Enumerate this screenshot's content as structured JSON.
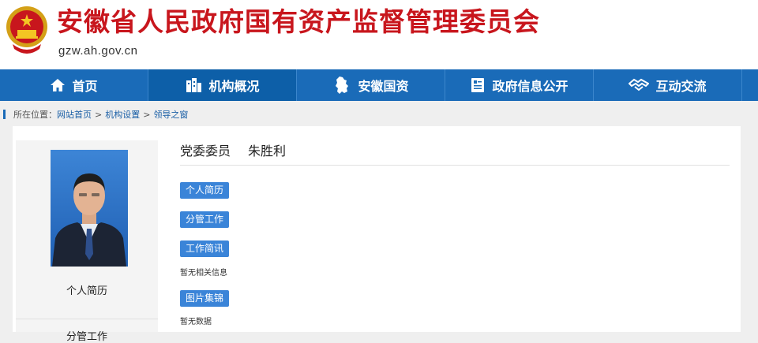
{
  "header": {
    "title": "安徽省人民政府国有资产监督管理委员会",
    "domain": "gzw.ah.gov.cn"
  },
  "nav": {
    "items": [
      {
        "label": "首页",
        "icon": "home-icon"
      },
      {
        "label": "机构概况",
        "icon": "building-icon"
      },
      {
        "label": "安徽国资",
        "icon": "province-map-icon"
      },
      {
        "label": "政府信息公开",
        "icon": "document-icon"
      },
      {
        "label": "互动交流",
        "icon": "handshake-icon"
      }
    ]
  },
  "breadcrumb": {
    "prefix": "所在位置：",
    "items": [
      "网站首页",
      "机构设置",
      "领导之窗"
    ],
    "separator": ">"
  },
  "profile": {
    "position": "党委委员",
    "name": "朱胜利"
  },
  "sidebar": {
    "links": [
      "个人简历",
      "分管工作"
    ]
  },
  "sections": [
    {
      "label": "个人简历",
      "note": ""
    },
    {
      "label": "分管工作",
      "note": ""
    },
    {
      "label": "工作简讯",
      "note": "暂无相关信息"
    },
    {
      "label": "图片集锦",
      "note": "暂无数据"
    }
  ],
  "colors": {
    "title_red": "#c8161d",
    "nav_blue": "#1a6bb8",
    "tag_blue": "#3a84d8"
  }
}
